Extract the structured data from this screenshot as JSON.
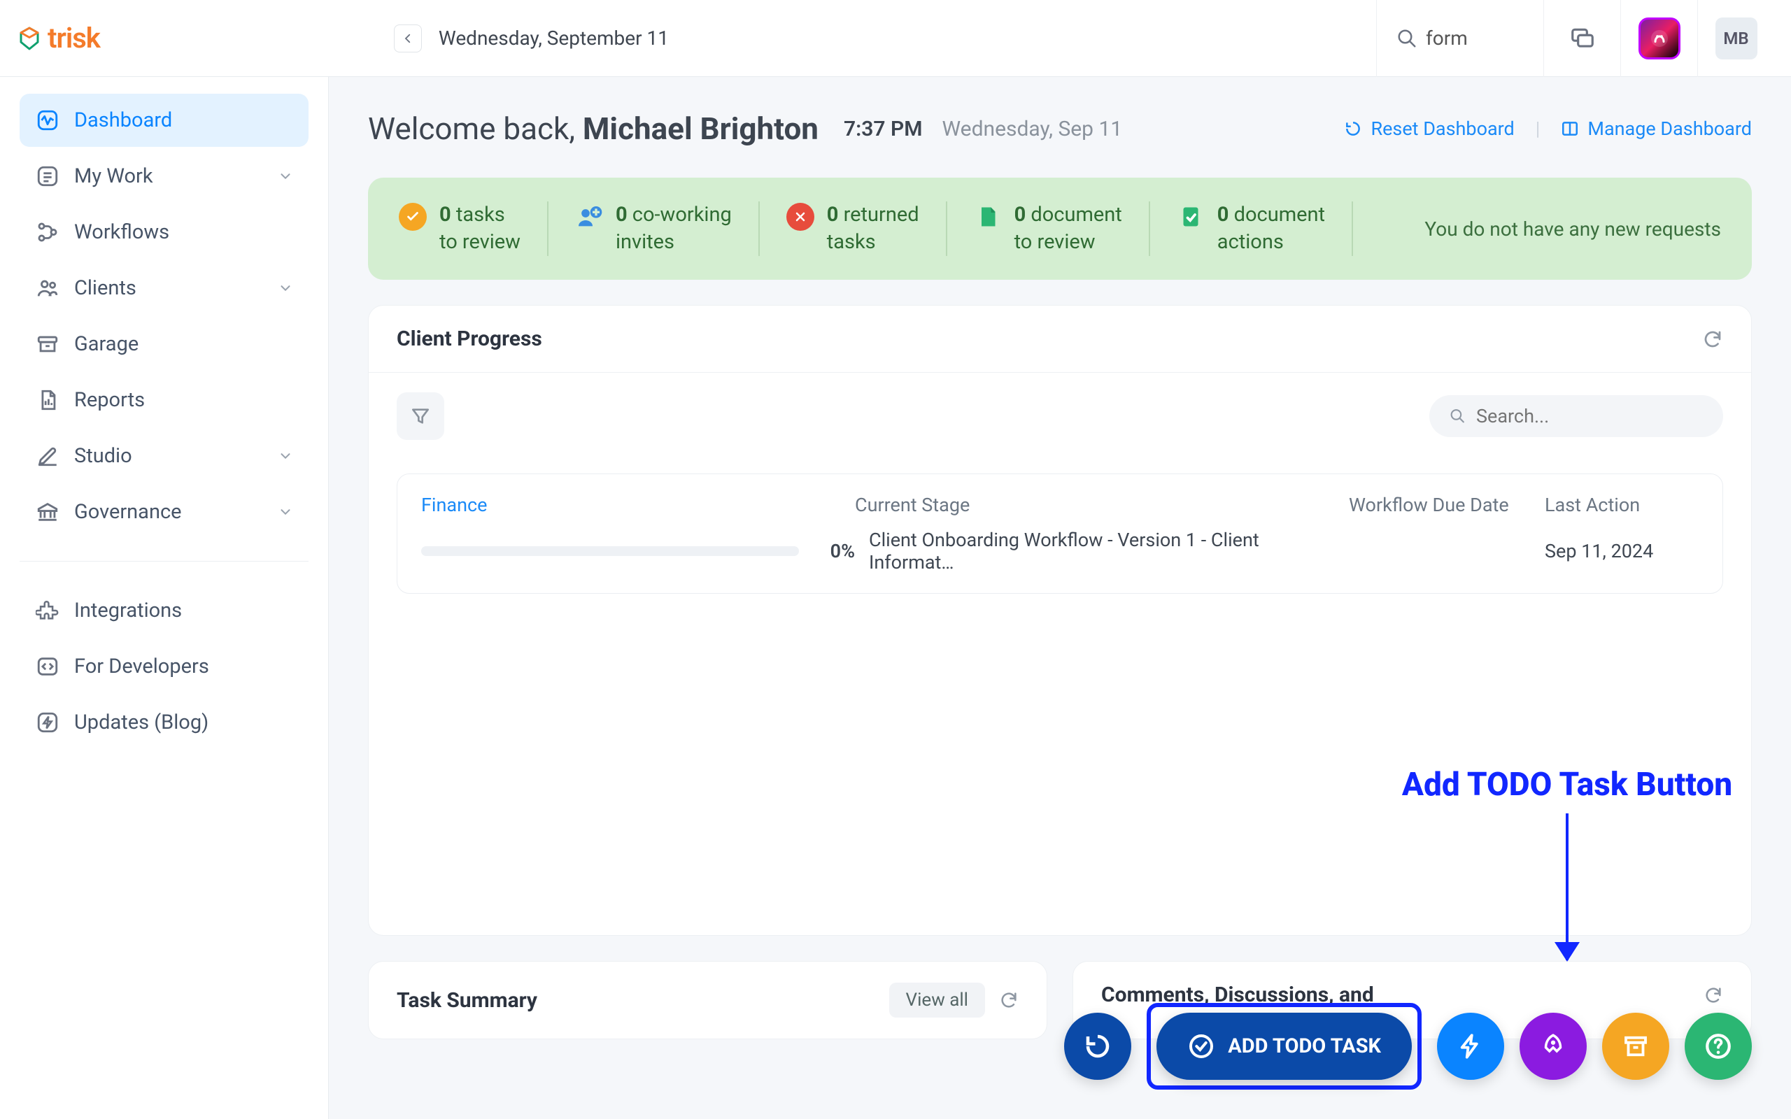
{
  "header": {
    "brand": "trisk",
    "date_label": "Wednesday, September 11",
    "search_value": "form",
    "avatar_initials": "MB"
  },
  "sidebar": {
    "items": [
      {
        "label": "Dashboard"
      },
      {
        "label": "My Work"
      },
      {
        "label": "Workflows"
      },
      {
        "label": "Clients"
      },
      {
        "label": "Garage"
      },
      {
        "label": "Reports"
      },
      {
        "label": "Studio"
      },
      {
        "label": "Governance"
      }
    ],
    "secondary": [
      {
        "label": "Integrations"
      },
      {
        "label": "For Developers"
      },
      {
        "label": "Updates (Blog)"
      }
    ]
  },
  "welcome": {
    "greeting_prefix": "Welcome back, ",
    "name": "Michael Brighton",
    "time": "7:37 PM",
    "date": "Wednesday, Sep 11",
    "reset_label": "Reset Dashboard",
    "manage_label": "Manage Dashboard"
  },
  "status": {
    "segs": [
      {
        "count": "0",
        "l1": " tasks",
        "l2": "to review"
      },
      {
        "count": "0",
        "l1": " co-working",
        "l2": "invites"
      },
      {
        "count": "0",
        "l1": " returned",
        "l2": "tasks"
      },
      {
        "count": "0",
        "l1": " document",
        "l2": "to review"
      },
      {
        "count": "0",
        "l1": " document",
        "l2": "actions"
      }
    ],
    "message": "You do not have any new requests"
  },
  "client_progress": {
    "title": "Client Progress",
    "search_placeholder": "Search...",
    "headers": {
      "client": "Finance",
      "stage": "Current Stage",
      "due": "Workflow Due Date",
      "last": "Last Action"
    },
    "row": {
      "pct": "0%",
      "stage": "Client Onboarding Workflow - Version 1 - Client Informat…",
      "due": "",
      "last": "Sep 11, 2024"
    }
  },
  "annotation": {
    "text": "Add TODO Task Button"
  },
  "fab": {
    "add_todo": "ADD TODO TASK"
  },
  "bottom": {
    "task_title": "Task Summary",
    "view_all": "View all",
    "comments_title": "Comments, Discussions, and"
  }
}
